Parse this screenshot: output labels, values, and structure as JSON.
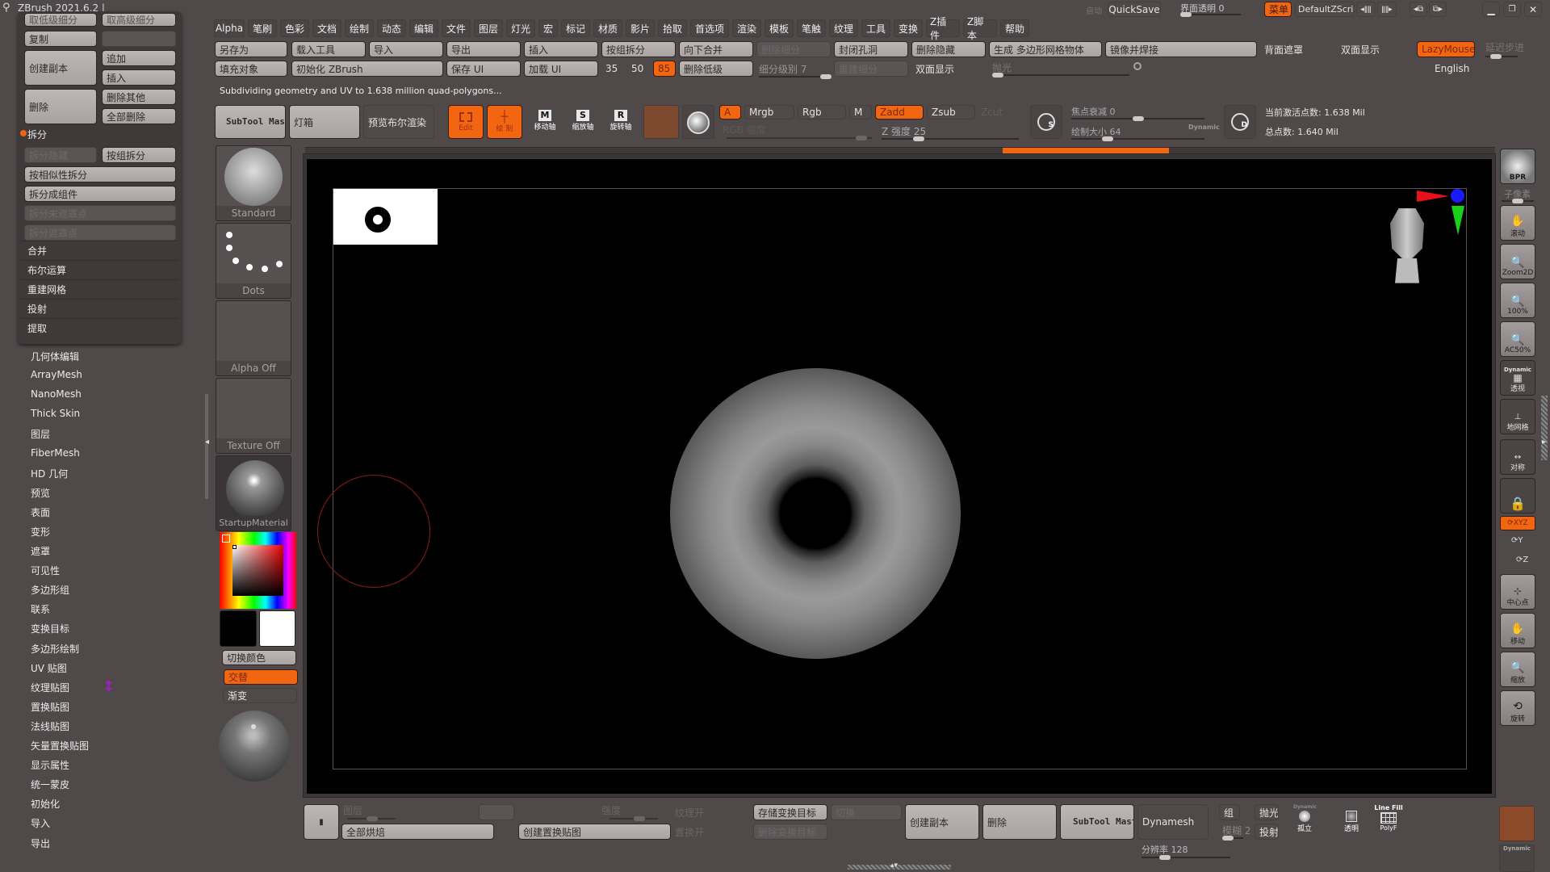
{
  "window": {
    "title": "ZBrush 2021.6.2 |",
    "quicksave_label": "QuickSave",
    "autosave_dim_label": "自动",
    "transparency_label": "界面透明 0",
    "menu_toggle_label": "菜单",
    "script_label": "DefaultZScript",
    "minimize_icon": "minimize-icon",
    "restore_icon": "restore-icon",
    "close_icon": "close-icon"
  },
  "menubar": {
    "items": [
      "Alpha",
      "笔刷",
      "色彩",
      "文档",
      "绘制",
      "动态",
      "编辑",
      "文件",
      "图层",
      "灯光",
      "宏",
      "标记",
      "材质",
      "影片",
      "拾取",
      "首选项",
      "渲染",
      "模板",
      "笔触",
      "纹理",
      "工具",
      "变换",
      "Z插件",
      "Z脚本",
      "帮助"
    ]
  },
  "shelf_row1": {
    "save_as": "另存为",
    "load_tool": "载入工具",
    "import": "导入",
    "export": "导出",
    "insert": "插入",
    "split_by_group": "按组拆分",
    "merge_down": "向下合并",
    "dim1": "删除细分",
    "close_holes": "封闭孔洞",
    "delete_hidden": "删除隐藏",
    "make_polymesh": "生成 多边形网格物体",
    "mirror_weld": "镜像并焊接",
    "backface_mask": "背面遮罩",
    "double_sided": "双面显示",
    "lazymouse": "LazyMouse",
    "lazy_step": "延迟步进"
  },
  "shelf_row2": {
    "fill_object": "填充对象",
    "init_zbrush": "初始化 ZBrush",
    "save_ui": "保存 UI",
    "load_ui": "加载 UI",
    "size_35": "35",
    "size_50": "50",
    "size_85": "85",
    "delete_lower": "删除低级",
    "subdiv_level": "细分级别 7",
    "dim2": "重建细分",
    "double_sided2": "双面显示",
    "polish": "抛光",
    "language": "English"
  },
  "status_message": "Subdividing geometry and UV to 1.638 million quad-polygons...",
  "toolbar": {
    "subtool_master": "SubTool Master",
    "lightbox": "灯箱",
    "preview_boolean": "预览布尔渲染",
    "edit_label": "Edit",
    "draw_label": "绘 制",
    "move_label": "移动轴",
    "scale_label": "缩放轴",
    "rotate_label": "旋转轴",
    "move_key": "M",
    "scale_key": "S",
    "rotate_key": "R",
    "a_label": "A",
    "mrgb": "Mrgb",
    "rgb": "Rgb",
    "m": "M",
    "zadd": "Zadd",
    "zsub": "Zsub",
    "zcut": "Zcut",
    "rgb_intensity": "RGB 强度",
    "z_intensity": "Z 强度 25",
    "focal_shift": "焦点衰减 0",
    "draw_size": "绘制大小 64",
    "dynamic": "Dynamic",
    "active_points": "当前激活点数: 1.638 Mil",
    "total_points": "总点数: 1.640 Mil",
    "s_key": "S",
    "d_key": "D",
    "z_intensity_value": 25,
    "focal_shift_value": 0,
    "draw_size_value": 64
  },
  "progress": {
    "fraction": 0.14
  },
  "left_panel": {
    "top_cut": [
      "取低级细分",
      "取高级细分"
    ],
    "duplicate": "复制",
    "create_copy": "创建副本",
    "append": "追加",
    "insert": "插入",
    "delete": "删除",
    "delete_other": "删除其他",
    "delete_all": "全部删除",
    "split_header": "拆分",
    "split_hidden": "拆分隐藏",
    "split_by_group": "按组拆分",
    "split_similar": "按相似性拆分",
    "split_parts": "拆分成组件",
    "dim_a": "拆分未遮罩点",
    "dim_b": "拆分遮罩点",
    "sections": [
      "合并",
      "布尔运算",
      "重建网格",
      "投射",
      "提取"
    ],
    "palette_items": [
      "几何体编辑",
      "ArrayMesh",
      "NanoMesh",
      "Thick Skin",
      "图层",
      "FiberMesh",
      "HD 几何",
      "预览",
      "表面",
      "变形",
      "遮罩",
      "可见性",
      "多边形组",
      "联系",
      "变换目标",
      "多边形绘制",
      "UV 贴图",
      "纹理贴图",
      "置换贴图",
      "法线贴图",
      "矢量置换贴图",
      "显示属性",
      "统一蒙皮",
      "初始化",
      "导入",
      "导出"
    ]
  },
  "tray": {
    "brush": "Standard",
    "stroke": "Dots",
    "alpha": "Alpha Off",
    "texture": "Texture Off",
    "material": "StartupMaterial",
    "switch_color": "切换颜色",
    "alternate": "交替",
    "gradient": "渐变"
  },
  "colors": {
    "accent": "#f26511",
    "primary_color": "#000000",
    "secondary_color": "#ffffff",
    "axis_x": "#e8101a",
    "axis_y": "#1ad11a",
    "axis_z": "#1a1aff"
  },
  "right_shelf": {
    "bpr": "BPR",
    "subpixel": "子像素",
    "scroll": "滚动",
    "zoom2d": "Zoom2D",
    "actual": "100%",
    "ac50": "AC50%",
    "persp_dyn": "Dynamic",
    "persp": "透视",
    "floor": "地网格",
    "symmetry": "对称",
    "xyz": "XYZ",
    "y": "Y",
    "z": "Z",
    "center": "中心点",
    "move": "移动",
    "scale": "缩放",
    "rotate": "旋转",
    "dynamic": "Dynamic"
  },
  "bottom": {
    "layer": "图层",
    "bake_all": "全部烘焙",
    "create_disp": "创建置换贴图",
    "texture_on": "纹理开",
    "disp_on": "置换开",
    "store_mt": "存储变换目标",
    "switch_mt": "切换",
    "delete_mt": "删除变换目标",
    "create_copy": "创建副本",
    "delete": "删除",
    "subtool_master": "SubTool Master",
    "dynamesh": "Dynamesh",
    "group": "组",
    "polish": "抛光",
    "blur": "模糊 2",
    "project": "投射",
    "resolution": "分辨率 128",
    "resolution_value": 128,
    "solo_dyn": "Dynamic",
    "solo": "孤立",
    "transp": "透明",
    "linefill": "Line Fill",
    "polyf": "PolyF",
    "intensity_label": "强度"
  }
}
